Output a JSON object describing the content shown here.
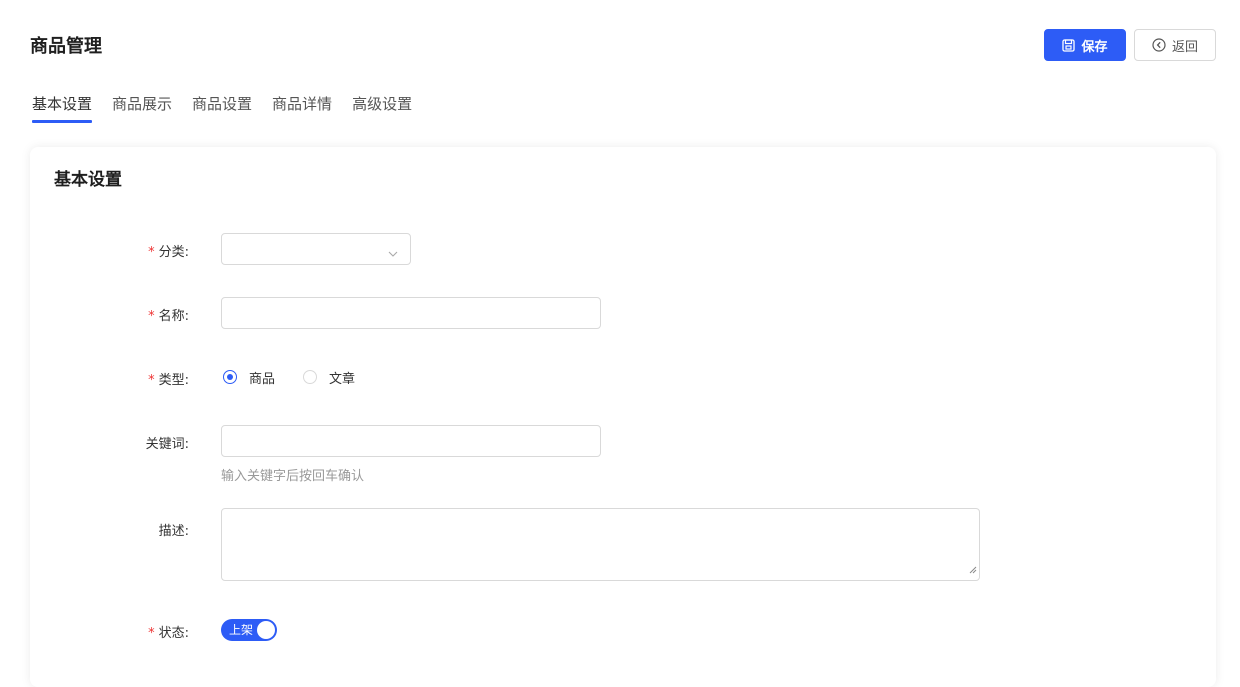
{
  "header": {
    "title": "商品管理",
    "save_label": "保存",
    "back_label": "返回"
  },
  "tabs": [
    {
      "label": "基本设置",
      "active": true
    },
    {
      "label": "商品展示",
      "active": false
    },
    {
      "label": "商品设置",
      "active": false
    },
    {
      "label": "商品详情",
      "active": false
    },
    {
      "label": "高级设置",
      "active": false
    }
  ],
  "form": {
    "section_title": "基本设置",
    "required_mark": "*",
    "category": {
      "label": "分类:",
      "value": ""
    },
    "name": {
      "label": "名称:",
      "value": ""
    },
    "type": {
      "label": "类型:",
      "options": [
        {
          "label": "商品",
          "checked": true
        },
        {
          "label": "文章",
          "checked": false
        }
      ]
    },
    "keywords": {
      "label": "关键词:",
      "value": "",
      "help": "输入关键字后按回车确认"
    },
    "description": {
      "label": "描述:",
      "value": ""
    },
    "status": {
      "label": "状态:",
      "switch_text": "上架",
      "on": true
    }
  },
  "colors": {
    "primary": "#2d5cf6",
    "required": "#e33333",
    "border": "#d9d9d9",
    "help_text": "#999999"
  }
}
